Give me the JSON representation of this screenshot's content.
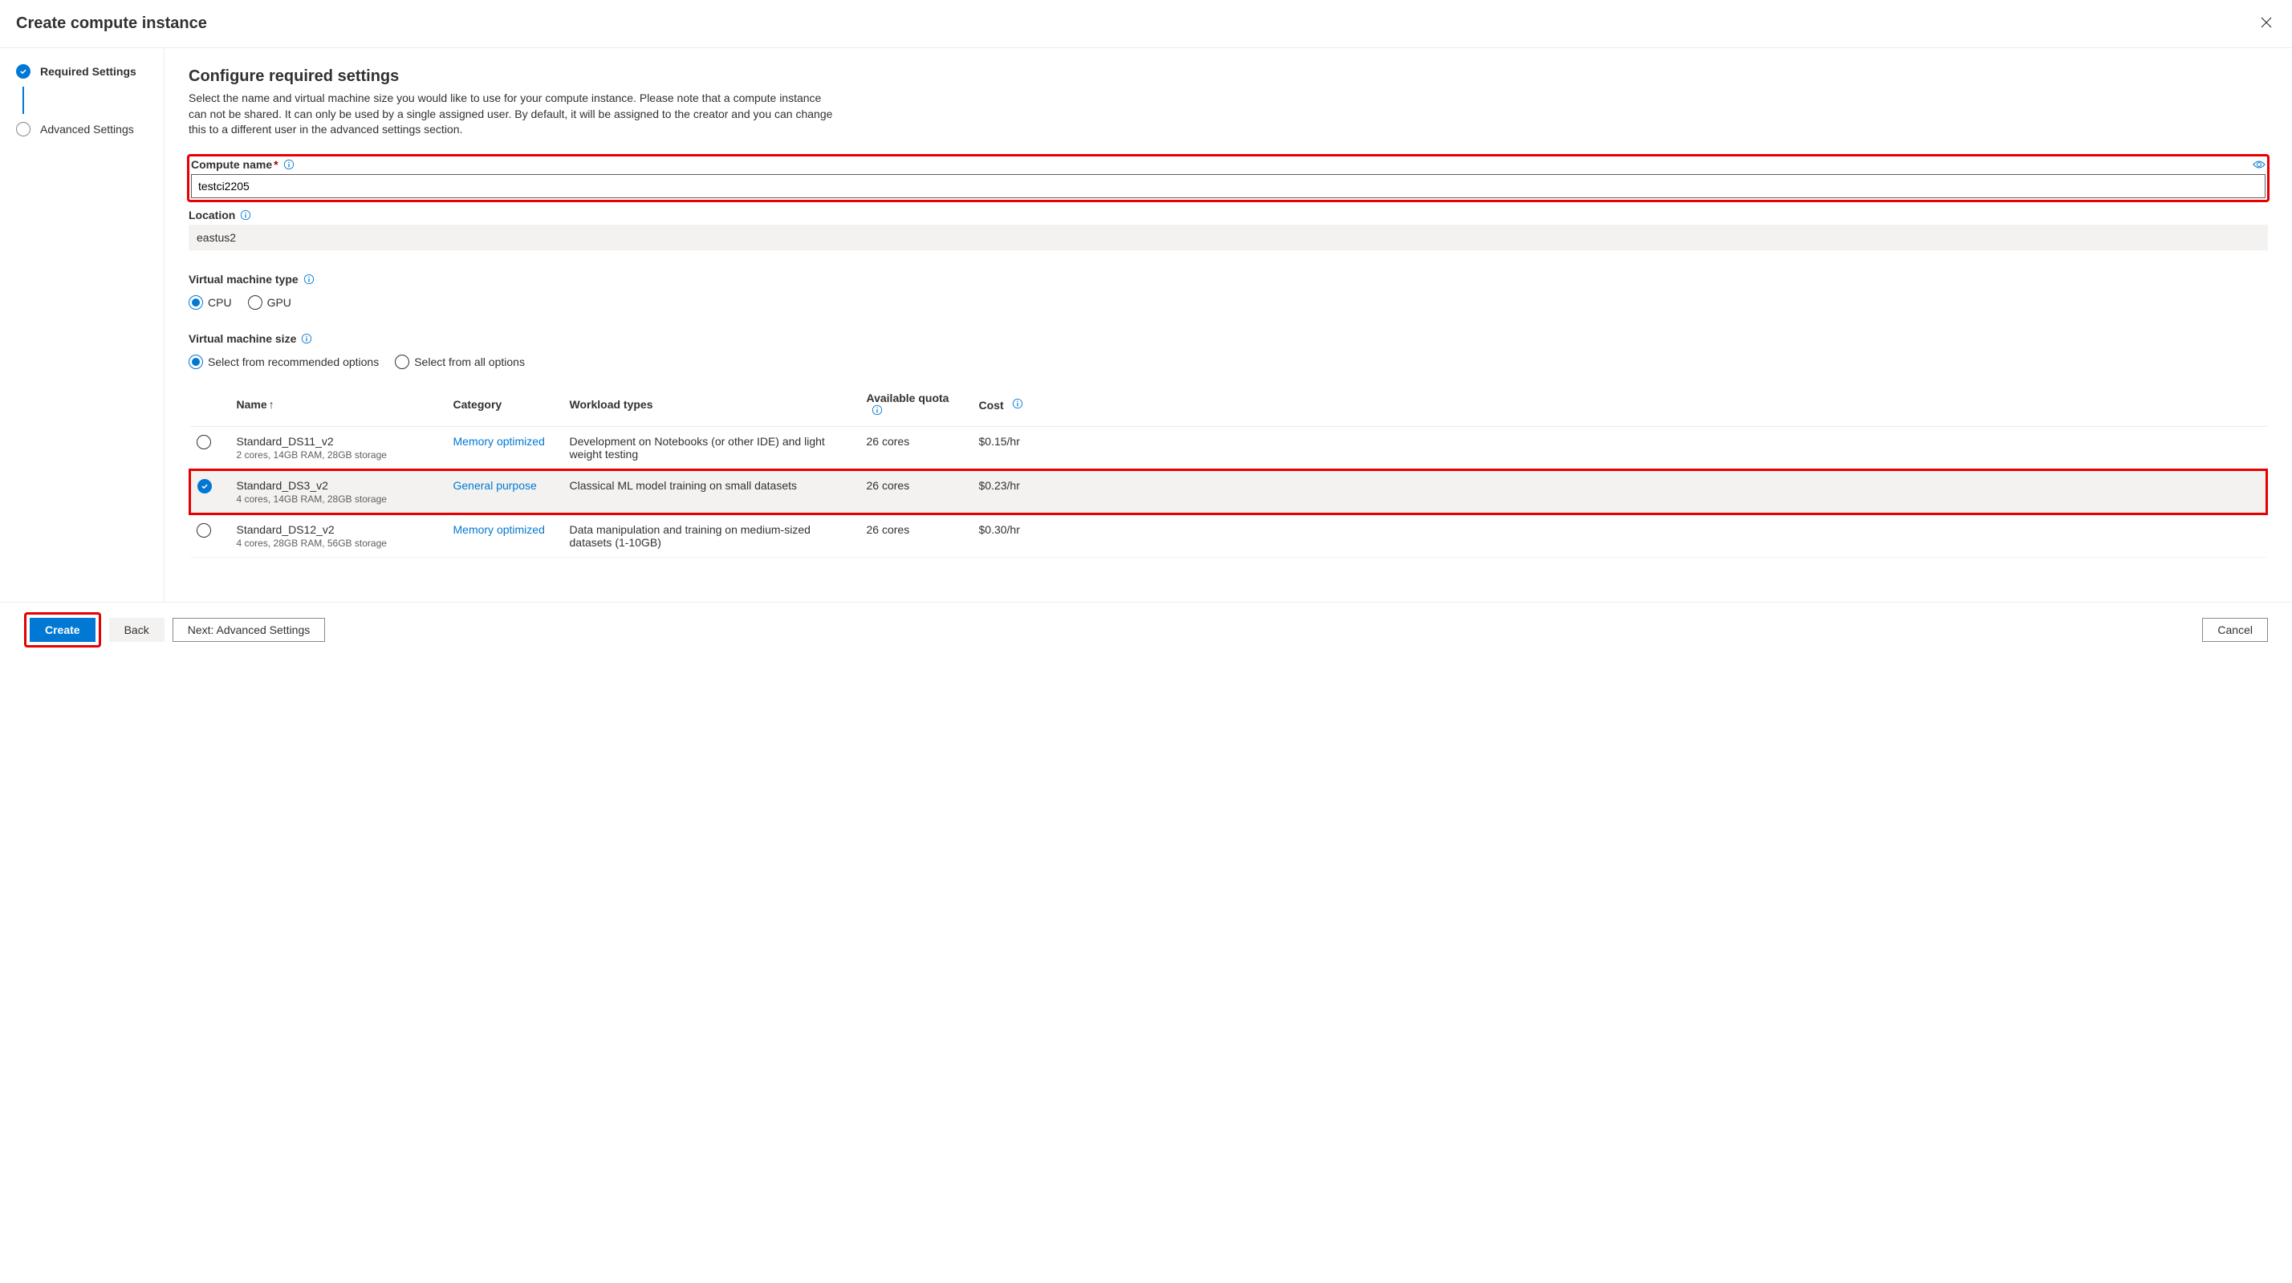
{
  "header": {
    "title": "Create compute instance"
  },
  "sidebar": {
    "steps": [
      {
        "label": "Required Settings",
        "state": "done"
      },
      {
        "label": "Advanced Settings",
        "state": "pending"
      }
    ]
  },
  "main": {
    "heading": "Configure required settings",
    "description": "Select the name and virtual machine size you would like to use for your compute instance. Please note that a compute instance can not be shared. It can only be used by a single assigned user. By default, it will be assigned to the creator and you can change this to a different user in the advanced settings section.",
    "compute_name": {
      "label": "Compute name",
      "value": "testci2205"
    },
    "location": {
      "label": "Location",
      "value": "eastus2"
    },
    "vm_type": {
      "label": "Virtual machine type",
      "options": [
        {
          "label": "CPU",
          "checked": true
        },
        {
          "label": "GPU",
          "checked": false
        }
      ]
    },
    "vm_size": {
      "label": "Virtual machine size",
      "options": [
        {
          "label": "Select from recommended options",
          "checked": true
        },
        {
          "label": "Select from all options",
          "checked": false
        }
      ]
    },
    "table": {
      "headers": {
        "name": "Name",
        "category": "Category",
        "workload": "Workload types",
        "quota": "Available quota",
        "cost": "Cost"
      },
      "rows": [
        {
          "selected": false,
          "name": "Standard_DS11_v2",
          "specs": "2 cores, 14GB RAM, 28GB storage",
          "category": "Memory optimized",
          "workload": "Development on Notebooks (or other IDE) and light weight testing",
          "quota": "26 cores",
          "cost": "$0.15/hr"
        },
        {
          "selected": true,
          "name": "Standard_DS3_v2",
          "specs": "4 cores, 14GB RAM, 28GB storage",
          "category": "General purpose",
          "workload": "Classical ML model training on small datasets",
          "quota": "26 cores",
          "cost": "$0.23/hr"
        },
        {
          "selected": false,
          "name": "Standard_DS12_v2",
          "specs": "4 cores, 28GB RAM, 56GB storage",
          "category": "Memory optimized",
          "workload": "Data manipulation and training on medium-sized datasets (1-10GB)",
          "quota": "26 cores",
          "cost": "$0.30/hr"
        }
      ]
    }
  },
  "footer": {
    "create": "Create",
    "back": "Back",
    "next": "Next: Advanced Settings",
    "cancel": "Cancel"
  }
}
